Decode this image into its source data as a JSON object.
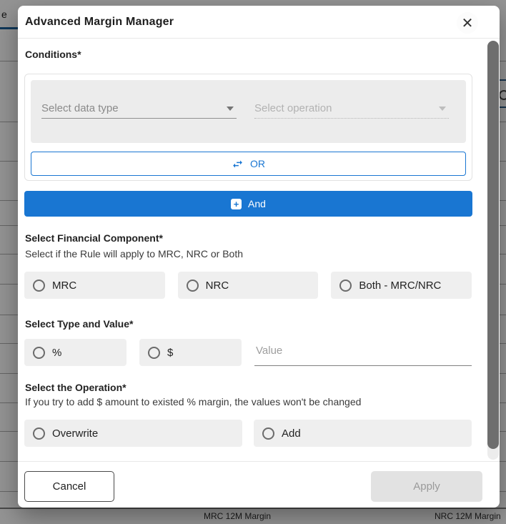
{
  "modal": {
    "title": "Advanced Margin Manager",
    "close_icon": "✕",
    "conditions": {
      "label": "Conditions*",
      "data_type_placeholder": "Select data type",
      "operation_placeholder": "Select operation",
      "or_label": "OR",
      "and_label": "And",
      "and_icon": "+"
    },
    "financial_component": {
      "label": "Select Financial Component*",
      "description": "Select if the Rule will apply to MRC, NRC or Both",
      "options": [
        "MRC",
        "NRC",
        "Both - MRC/NRC"
      ]
    },
    "type_and_value": {
      "label": "Select Type and Value*",
      "options": [
        "%",
        "$"
      ],
      "value_placeholder": "Value"
    },
    "operation": {
      "label": "Select the Operation*",
      "description": "If you try to add $ amount to existed % margin, the values won't be changed",
      "options": [
        "Overwrite",
        "Add"
      ]
    },
    "footer": {
      "cancel_label": "Cancel",
      "apply_label": "Apply"
    }
  },
  "background": {
    "partial_tab_text": "e",
    "bottom_labels": [
      "MRC 12M Margin",
      "NRC 12M Margin"
    ]
  },
  "colors": {
    "accent_blue": "#1976d2",
    "tab_indicator_blue": "#1a5f99",
    "disabled_button_bg": "#e2e2e2",
    "disabled_button_text": "#9a9a9a",
    "scrollbar_thumb": "#6e6e6e",
    "option_box_bg": "#efefef",
    "overlay": "rgba(0,0,0,0.42)"
  }
}
